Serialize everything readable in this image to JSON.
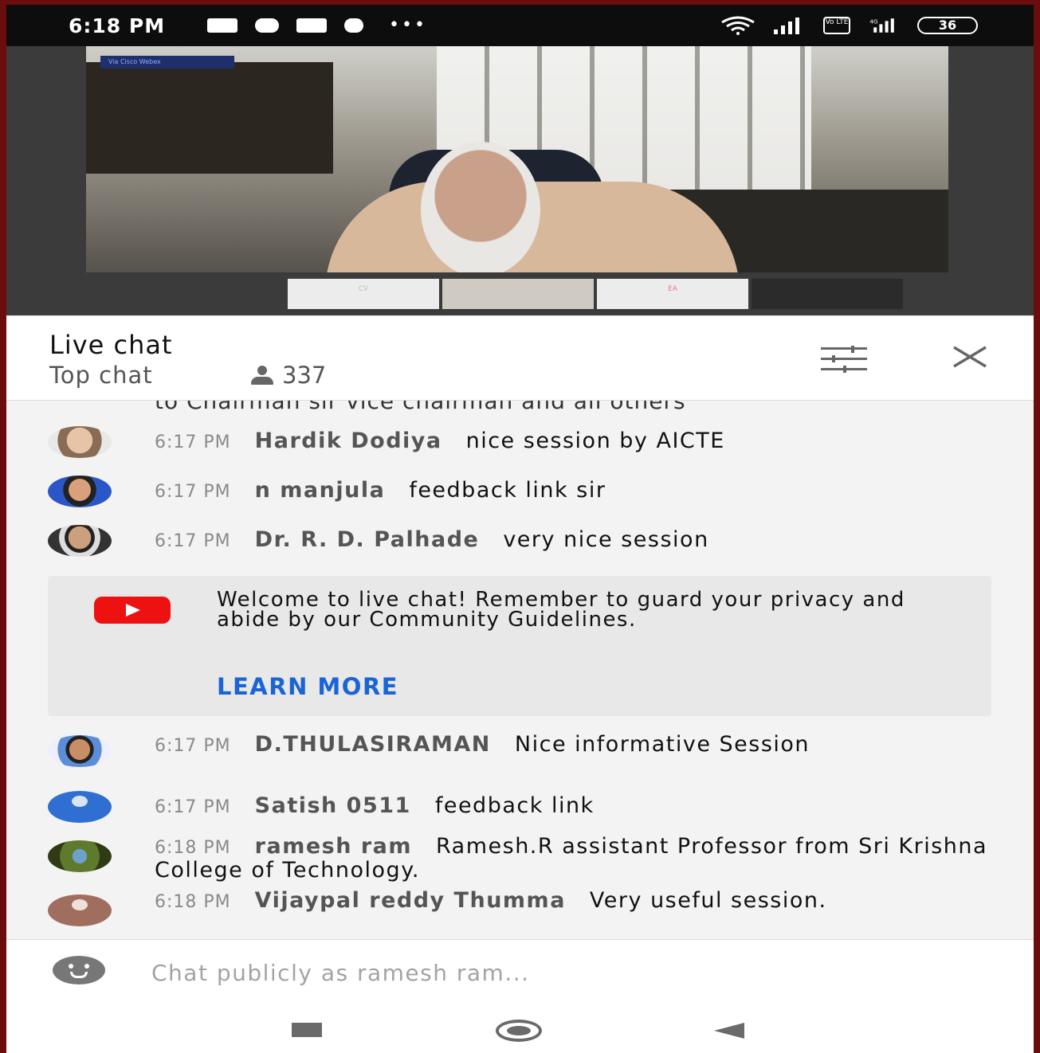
{
  "status_bar": {
    "time": "6:18 PM",
    "battery": "36",
    "volte": "Vo LTE",
    "network": "4G"
  },
  "video": {
    "badge": "Via Cisco Webex",
    "thumb_labels": [
      "CV",
      "",
      "EA",
      ""
    ]
  },
  "chat_header": {
    "title": "Live chat",
    "mode": "Top chat",
    "viewer_count": "337"
  },
  "cut_message": "to Chairman sir vice chairman and all others",
  "messages": [
    {
      "time": "6:17 PM",
      "author": "Hardik Dodiya",
      "text": "nice session by AICTE"
    },
    {
      "time": "6:17 PM",
      "author": "n manjula",
      "text": "feedback link sir"
    },
    {
      "time": "6:17 PM",
      "author": "Dr. R. D. Palhade",
      "text": "very nice session"
    },
    {
      "time": "6:17 PM",
      "author": "D.THULASIRAMAN",
      "text": "Nice informative Session"
    },
    {
      "time": "6:17 PM",
      "author": "Satish 0511",
      "text": "feedback link"
    },
    {
      "time": "6:18 PM",
      "author": "ramesh ram",
      "text": "Ramesh.R assistant Professor from Sri Krishna College of Technology."
    },
    {
      "time": "6:18 PM",
      "author": "Vijaypal reddy Thumma",
      "text": "Very useful session."
    }
  ],
  "welcome": {
    "text": "Welcome to live chat! Remember to guard your privacy and abide by our Community Guidelines.",
    "learn_more": "LEARN MORE"
  },
  "input": {
    "placeholder": "Chat publicly as ramesh ram..."
  },
  "colors": {
    "accent_blue": "#1a64d6",
    "youtube_red": "#ee1111",
    "frame_red": "#6b0d0d"
  },
  "icons": [
    "message-icon",
    "sync-icon",
    "mail-icon",
    "chrome-icon",
    "wifi-icon",
    "signal-icon",
    "battery-icon",
    "person-icon",
    "tune-icon",
    "close-icon",
    "youtube-logo-icon",
    "emoji-icon",
    "recents-icon",
    "home-icon",
    "back-icon"
  ]
}
